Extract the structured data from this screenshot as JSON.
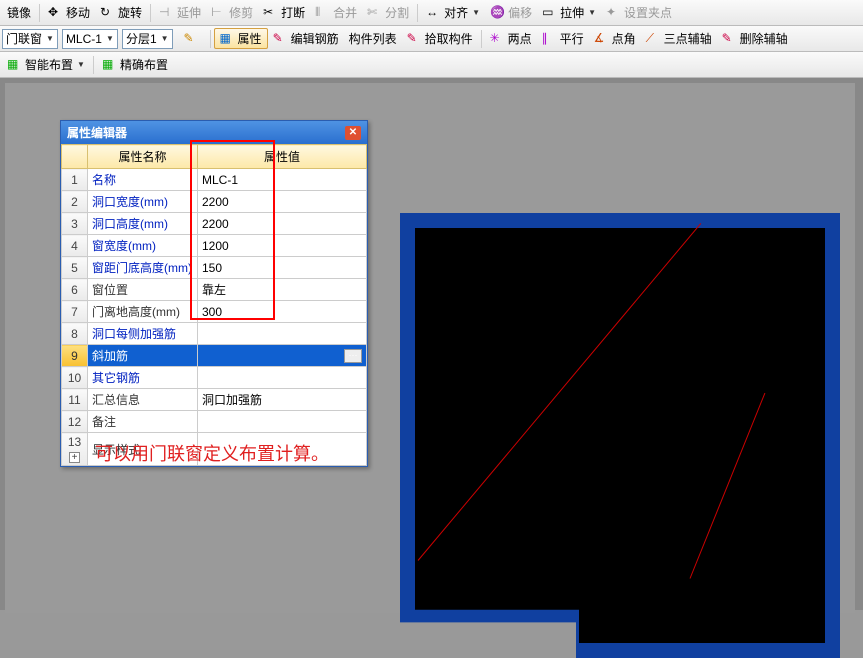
{
  "toolbar1": {
    "mirror": "镜像",
    "move": "移动",
    "rotate": "旋转",
    "extend": "延伸",
    "trim": "修剪",
    "break": "打断",
    "merge": "合并",
    "split": "分割",
    "align": "对齐",
    "offset": "偏移",
    "stretch": "拉伸",
    "setgrip": "设置夹点"
  },
  "toolbar2": {
    "category": "门联窗",
    "component": "MLC-1",
    "layer": "分层1",
    "attributes": "属性",
    "editrebar": "编辑钢筋",
    "componentlist": "构件列表",
    "pickcomponent": "拾取构件",
    "twopoint": "两点",
    "parallel": "平行",
    "pointangle": "点角",
    "threepoint": "三点辅轴",
    "deleteaxis": "删除辅轴"
  },
  "toolbar3": {
    "smartlayout": "智能布置",
    "preciselayout": "精确布置"
  },
  "panel": {
    "title": "属性编辑器",
    "col_name": "属性名称",
    "col_value": "属性值",
    "rows": [
      {
        "n": "1",
        "name": "名称",
        "value": "MLC-1",
        "link": true
      },
      {
        "n": "2",
        "name": "洞口宽度(mm)",
        "value": "2200",
        "link": true
      },
      {
        "n": "3",
        "name": "洞口高度(mm)",
        "value": "2200",
        "link": true
      },
      {
        "n": "4",
        "name": "窗宽度(mm)",
        "value": "1200",
        "link": true
      },
      {
        "n": "5",
        "name": "窗距门底高度(mm)",
        "value": "150",
        "link": true
      },
      {
        "n": "6",
        "name": "窗位置",
        "value": "靠左",
        "link": false
      },
      {
        "n": "7",
        "name": "门离地高度(mm)",
        "value": "300",
        "link": false
      },
      {
        "n": "8",
        "name": "洞口每侧加强筋",
        "value": "",
        "link": true
      },
      {
        "n": "9",
        "name": "斜加筋",
        "value": "",
        "link": true,
        "selected": true,
        "ellipsis": true
      },
      {
        "n": "10",
        "name": "其它钢筋",
        "value": "",
        "link": true
      },
      {
        "n": "11",
        "name": "汇总信息",
        "value": "洞口加强筋",
        "link": false
      },
      {
        "n": "12",
        "name": "备注",
        "value": "",
        "link": false
      },
      {
        "n": "13",
        "name": "显示样式",
        "value": "",
        "link": false,
        "expand": true
      }
    ]
  },
  "annotation": "可以用门联窗定义布置计算。"
}
